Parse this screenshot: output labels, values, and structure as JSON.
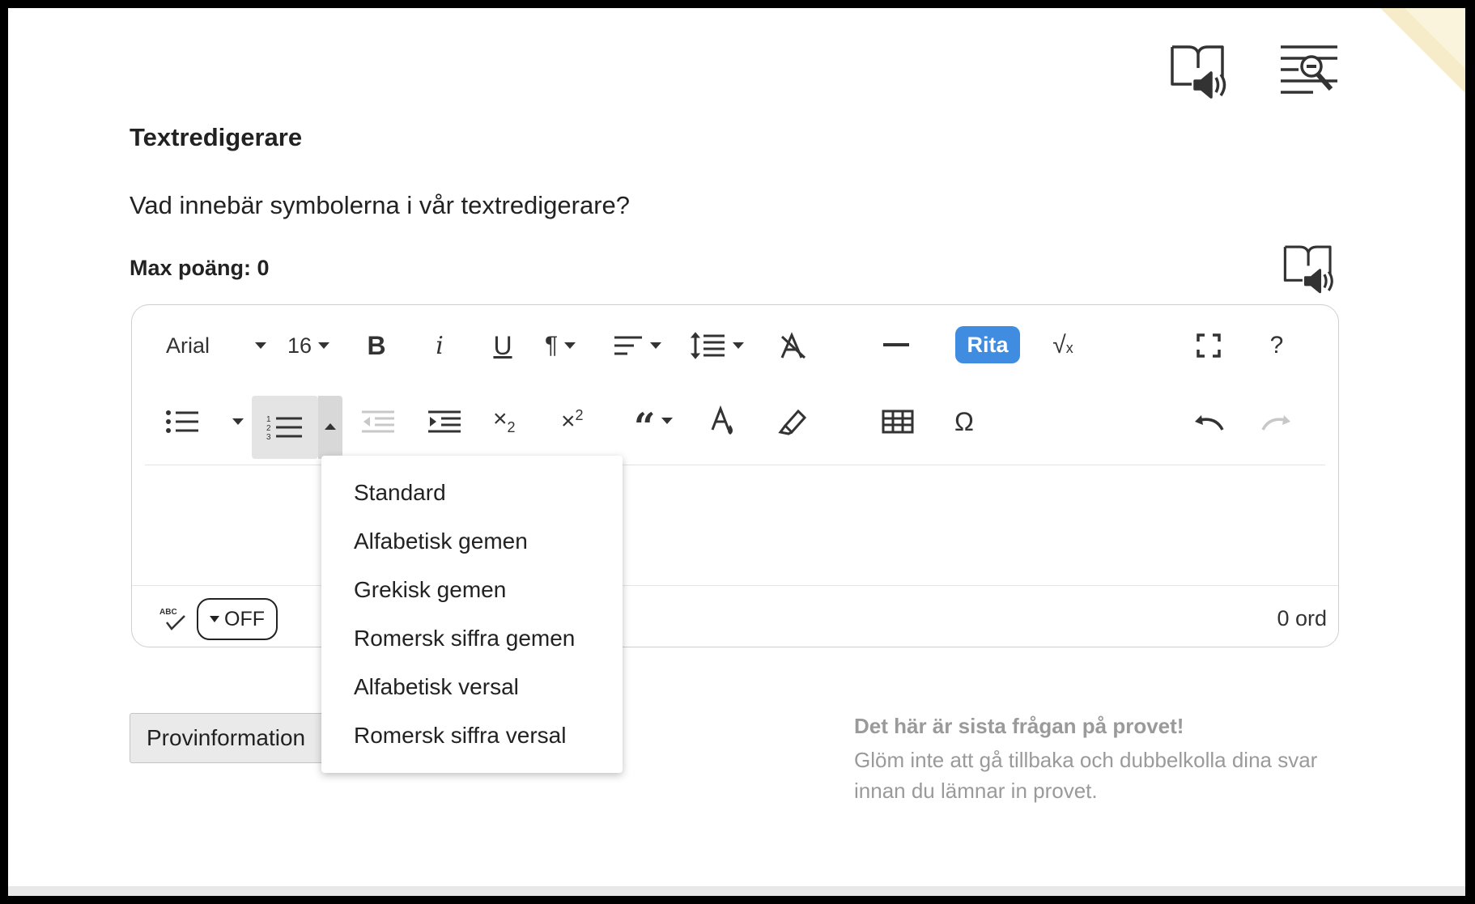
{
  "question": {
    "title": "Textredigerare",
    "text": "Vad innebär symbolerna i vår textredigerare?",
    "max_points": "Max poäng: 0"
  },
  "editor": {
    "font_family": "Arial",
    "font_size": "16",
    "draw_label": "Rita",
    "help_label": "?",
    "spellcheck_abc": "ABC",
    "spellcheck_state": "OFF",
    "word_count": "0 ord"
  },
  "list_style_dropdown": {
    "items": [
      "Standard",
      "Alfabetisk gemen",
      "Grekisk gemen",
      "Romersk siffra gemen",
      "Alfabetisk versal",
      "Romersk siffra versal"
    ]
  },
  "footer": {
    "info_button": "Provinformation",
    "last_question_title": "Det här är sista frågan på provet!",
    "last_question_text": "Glöm inte att gå tillbaka och dubbelkolla dina svar innan du lämnar in provet."
  },
  "colors": {
    "accent": "#3f8ce0",
    "corner": "#f6ecc9",
    "muted_text": "#9a9a9a"
  }
}
